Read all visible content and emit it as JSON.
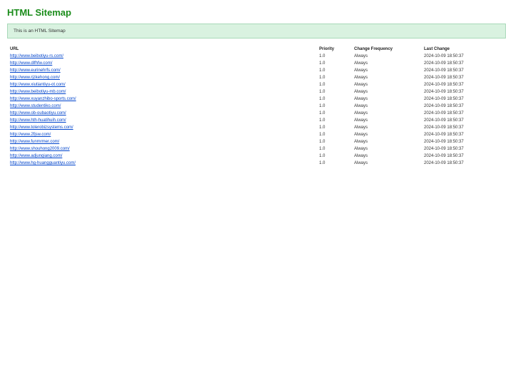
{
  "title": "HTML Sitemap",
  "intro": "This is an HTML Sitemap",
  "headers": {
    "url": "URL",
    "priority": "Priority",
    "freq": "Change Frequency",
    "last": "Last Change"
  },
  "defaults": {
    "priority": "1.0",
    "freq": "Always",
    "last": "2024-10-09 18:50:37"
  },
  "rows": [
    {
      "url": "http://www.beibotiyu-rs.com/"
    },
    {
      "url": "http://www.dlfhfw.com/"
    },
    {
      "url": "http://www.eurinehrfs.com/"
    },
    {
      "url": "http://www.rjzkehong.com/"
    },
    {
      "url": "http://www.xiutiantiyu-ot.com/"
    },
    {
      "url": "http://www.beibotiyu-mb.com/"
    },
    {
      "url": "http://www.xuyanzhibo-sports.com/"
    },
    {
      "url": "http://www.studentiko.com/"
    },
    {
      "url": "http://www.ob-oubaotiyu.com/"
    },
    {
      "url": "http://www.hth-huatihuih.com/"
    },
    {
      "url": "http://www.tolerobizsystems.com/"
    },
    {
      "url": "http://www.2fjsw.com/"
    },
    {
      "url": "http://www.funmrmer.com/"
    },
    {
      "url": "http://www.shouhong2009.com/"
    },
    {
      "url": "http://www.adjunqiang.com/"
    },
    {
      "url": "http://www.hg-huangguantiyu.com/"
    }
  ]
}
